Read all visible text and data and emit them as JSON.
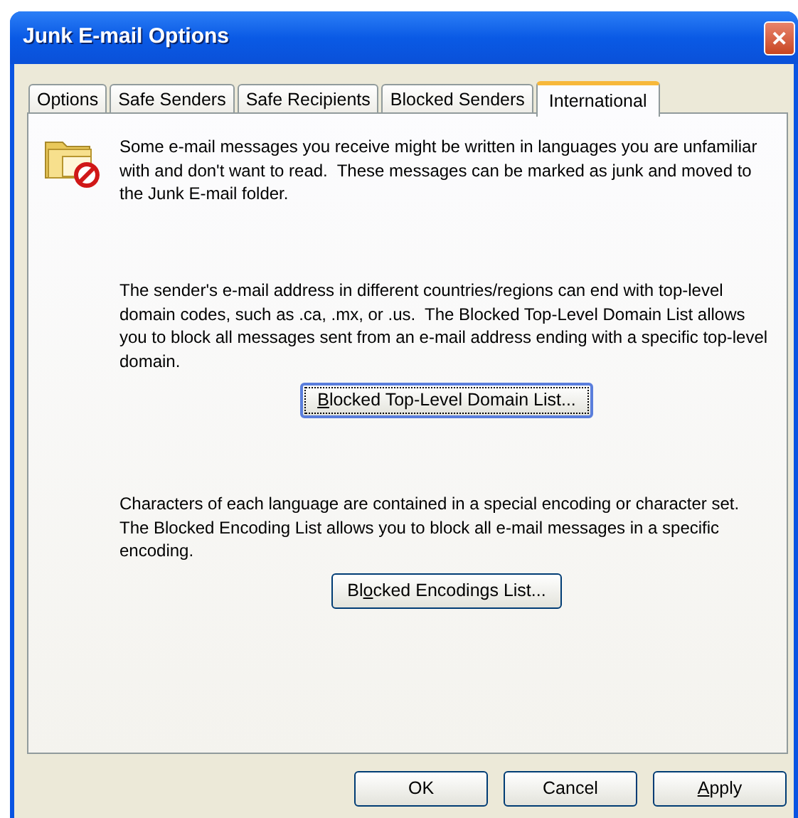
{
  "window": {
    "title": "Junk E-mail Options",
    "close": "✕"
  },
  "tabs": [
    {
      "label": "Options",
      "selected": false
    },
    {
      "label": "Safe Senders",
      "selected": false
    },
    {
      "label": "Safe Recipients",
      "selected": false
    },
    {
      "label": "Blocked Senders",
      "selected": false
    },
    {
      "label": "International",
      "selected": true
    }
  ],
  "intro": "Some e-mail messages you receive might be written in languages you are unfamiliar with and don't want to read.  These messages can be marked as junk and moved to the Junk E-mail folder.",
  "sections": [
    {
      "text": "The sender's e-mail address in different countries/regions can end with top-level domain codes, such as .ca, .mx, or .us.  The Blocked Top-Level Domain List allows you to block all messages sent from an e-mail address ending with a specific top-level domain.",
      "button": {
        "key": "B",
        "after": "locked Top-Level Domain List...",
        "focused": true
      }
    },
    {
      "text": "Characters of each language are contained in a special encoding or character set.  The Blocked Encoding List allows you to block all e-mail messages in a specific encoding.",
      "button": {
        "before": "Bl",
        "key": "o",
        "after": "cked Encodings List...",
        "focused": false
      }
    }
  ],
  "buttons": [
    {
      "before": "OK"
    },
    {
      "before": "Cancel"
    },
    {
      "key": "A",
      "after": "pply"
    }
  ]
}
